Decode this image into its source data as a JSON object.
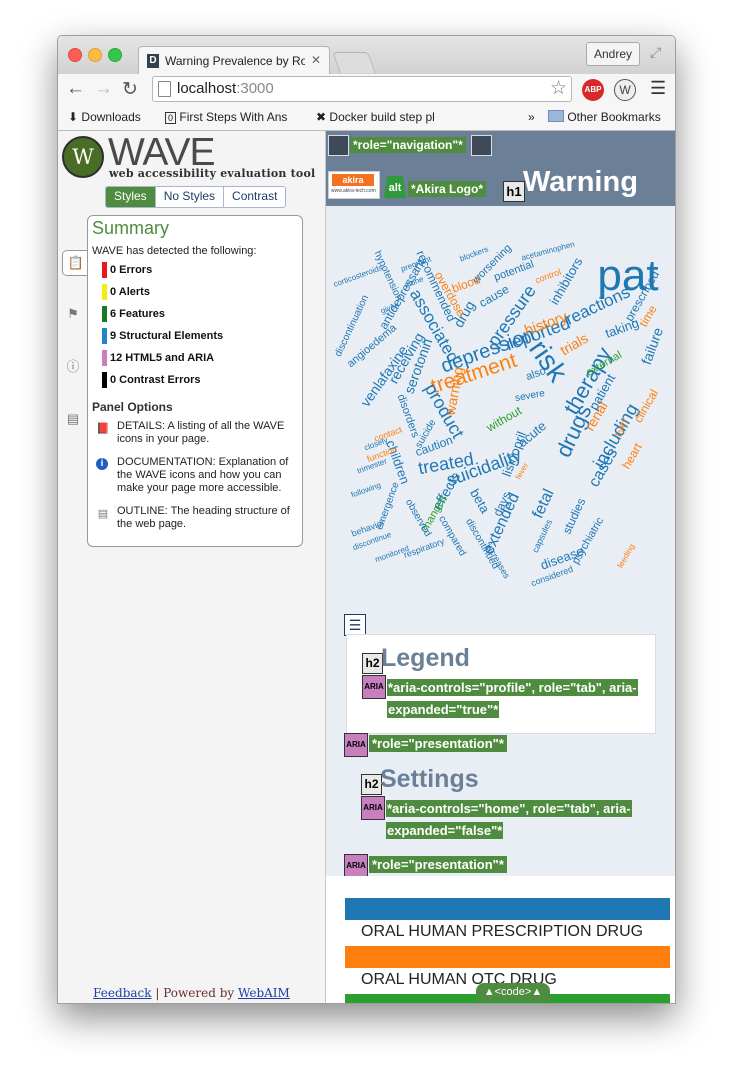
{
  "browser": {
    "tab_title": "Warning Prevalence by Rou",
    "tab_favicon": "D",
    "user": "Andrey",
    "url_host": "localhost",
    "url_port": ":3000",
    "bookmarks": [
      "Downloads",
      "First Steps With Ans",
      "Docker build step pl",
      "Other Bookmarks"
    ],
    "bookmark_overflow": "»"
  },
  "wave": {
    "logo_text": "WAVE",
    "subtitle": "web accessibility evaluation tool",
    "view_buttons": [
      "Styles",
      "No Styles",
      "Contrast"
    ],
    "summary_title": "Summary",
    "detected_text": "WAVE has detected the following:",
    "categories": [
      {
        "label": "0 Errors",
        "color": "#e3191b"
      },
      {
        "label": "0 Alerts",
        "color": "#f5ec16"
      },
      {
        "label": "6 Features",
        "color": "#167a26"
      },
      {
        "label": "9 Structural Elements",
        "color": "#1f86c8"
      },
      {
        "label": "12 HTML5 and ARIA",
        "color": "#c77fc0"
      },
      {
        "label": "0 Contrast Errors",
        "color": "#000000"
      }
    ],
    "panel_options_title": "Panel Options",
    "panel_options": [
      {
        "icon": "book-icon",
        "text": "DETAILS: A listing of all the WAVE icons in your page."
      },
      {
        "icon": "info-icon",
        "text": "DOCUMENTATION: Explanation of the WAVE icons and how you can make your page more accessible."
      },
      {
        "icon": "outline-icon",
        "text": "OUTLINE: The heading structure of the web page."
      }
    ],
    "footer_feedback": "Feedback",
    "footer_sep": " | Powered by ",
    "footer_webaim": "WebAIM"
  },
  "page": {
    "nav_label": "*role=\"navigation\"*",
    "akira_logo": "akira",
    "akira_url": "www.akira-tech.com",
    "alt_badge": "alt",
    "alt_label": "*Akira Logo*",
    "h1_badge": "h1",
    "title": "Warning",
    "word_cloud": [
      {
        "w": "pat",
        "size": 44,
        "color": "#1f77b4"
      },
      {
        "w": "risk",
        "size": 28,
        "color": "#1f77b4"
      },
      {
        "w": "treatment",
        "size": 21,
        "color": "#ff7f0e"
      },
      {
        "w": "therapy",
        "size": 22,
        "color": "#1f77b4"
      },
      {
        "w": "depression",
        "size": 20,
        "color": "#1f77b4"
      },
      {
        "w": "drugs",
        "size": 22,
        "color": "#1f77b4"
      },
      {
        "w": "pressure",
        "size": 18,
        "color": "#1f77b4"
      },
      {
        "w": "reported",
        "size": 18,
        "color": "#1f77b4"
      },
      {
        "w": "product",
        "size": 18,
        "color": "#1f77b4"
      },
      {
        "w": "treated",
        "size": 18,
        "color": "#1f77b4"
      },
      {
        "w": "suicidality",
        "size": 18,
        "color": "#1f77b4"
      },
      {
        "w": "associated",
        "size": 17,
        "color": "#1f77b4"
      },
      {
        "w": "reactions",
        "size": 17,
        "color": "#1f77b4"
      },
      {
        "w": "including",
        "size": 18,
        "color": "#1f77b4"
      },
      {
        "w": "cases",
        "size": 16,
        "color": "#1f77b4"
      },
      {
        "w": "extended",
        "size": 16,
        "color": "#1f77b4"
      },
      {
        "w": "fetal",
        "size": 16,
        "color": "#1f77b4"
      },
      {
        "w": "disease",
        "size": 13,
        "color": "#1f77b4"
      },
      {
        "w": "history",
        "size": 15,
        "color": "#ff7f0e"
      },
      {
        "w": "trials",
        "size": 14,
        "color": "#ff7f0e"
      },
      {
        "w": "renal",
        "size": 14,
        "color": "#ff7f0e"
      },
      {
        "w": "warning",
        "size": 14,
        "color": "#ff7f0e"
      },
      {
        "w": "children",
        "size": 13,
        "color": "#1f77b4"
      },
      {
        "w": "effects",
        "size": 14,
        "color": "#1f77b4"
      },
      {
        "w": "serotonin",
        "size": 14,
        "color": "#1f77b4"
      },
      {
        "w": "receiving",
        "size": 14,
        "color": "#1f77b4"
      },
      {
        "w": "venlafaxine",
        "size": 14,
        "color": "#1f77b4"
      },
      {
        "w": "drug",
        "size": 14,
        "color": "#1f77b4"
      },
      {
        "w": "inhibitors",
        "size": 13,
        "color": "#1f77b4"
      },
      {
        "w": "recommended",
        "size": 12,
        "color": "#1f77b4"
      },
      {
        "w": "antidepressant",
        "size": 12,
        "color": "#1f77b4"
      },
      {
        "w": "caution",
        "size": 12,
        "color": "#1f77b4"
      },
      {
        "w": "lisinopril",
        "size": 13,
        "color": "#1f77b4"
      },
      {
        "w": "acute",
        "size": 13,
        "color": "#1f77b4"
      },
      {
        "w": "beta",
        "size": 13,
        "color": "#1f77b4"
      },
      {
        "w": "days",
        "size": 12,
        "color": "#1f77b4"
      },
      {
        "w": "studies",
        "size": 12,
        "color": "#1f77b4"
      },
      {
        "w": "psychiatric",
        "size": 11,
        "color": "#1f77b4"
      },
      {
        "w": "changes",
        "size": 11,
        "color": "#2ca02c"
      },
      {
        "w": "without",
        "size": 12,
        "color": "#2ca02c"
      },
      {
        "w": "external",
        "size": 11,
        "color": "#2ca02c"
      },
      {
        "w": "overdose",
        "size": 12,
        "color": "#ff7f0e"
      },
      {
        "w": "blood",
        "size": 12,
        "color": "#ff7f0e"
      },
      {
        "w": "angioedema",
        "size": 11,
        "color": "#1f77b4"
      },
      {
        "w": "discontinuation",
        "size": 10,
        "color": "#1f77b4"
      },
      {
        "w": "hypotension",
        "size": 10,
        "color": "#1f77b4"
      },
      {
        "w": "potential",
        "size": 11,
        "color": "#1f77b4"
      },
      {
        "w": "worsening",
        "size": 11,
        "color": "#1f77b4"
      },
      {
        "w": "cause",
        "size": 12,
        "color": "#1f77b4"
      },
      {
        "w": "disorders",
        "size": 11,
        "color": "#1f77b4"
      },
      {
        "w": "severe",
        "size": 10,
        "color": "#1f77b4"
      },
      {
        "w": "emergence",
        "size": 10,
        "color": "#1f77b4"
      },
      {
        "w": "observed",
        "size": 10,
        "color": "#1f77b4"
      },
      {
        "w": "compared",
        "size": 10,
        "color": "#1f77b4"
      },
      {
        "w": "respiratory",
        "size": 9,
        "color": "#1f77b4"
      },
      {
        "w": "discontinued",
        "size": 10,
        "color": "#1f77b4"
      },
      {
        "w": "increases",
        "size": 9,
        "color": "#1f77b4"
      },
      {
        "w": "considered",
        "size": 9,
        "color": "#1f77b4"
      },
      {
        "w": "feeding",
        "size": 8,
        "color": "#ff7f0e"
      },
      {
        "w": "taking",
        "size": 13,
        "color": "#1f77b4"
      },
      {
        "w": "failure",
        "size": 14,
        "color": "#1f77b4"
      },
      {
        "w": "time",
        "size": 12,
        "color": "#ff7f0e"
      },
      {
        "w": "heart",
        "size": 12,
        "color": "#ff7f0e"
      },
      {
        "w": "clinical",
        "size": 12,
        "color": "#ff7f0e"
      },
      {
        "w": "patient",
        "size": 13,
        "color": "#1f77b4"
      },
      {
        "w": "liver",
        "size": 10,
        "color": "#ff7f0e"
      },
      {
        "w": "pregnant",
        "size": 8,
        "color": "#1f77b4"
      },
      {
        "w": "corticosteroids",
        "size": 8,
        "color": "#1f77b4"
      },
      {
        "w": "blockers",
        "size": 8,
        "color": "#1f77b4"
      },
      {
        "w": "acetaminophen",
        "size": 8,
        "color": "#1f77b4"
      },
      {
        "w": "control",
        "size": 9,
        "color": "#ff7f0e"
      },
      {
        "w": "contact",
        "size": 9,
        "color": "#ff7f0e"
      },
      {
        "w": "function",
        "size": 9,
        "color": "#ff7f0e"
      },
      {
        "w": "suicide",
        "size": 10,
        "color": "#1f77b4"
      },
      {
        "w": "alone",
        "size": 8,
        "color": "#1f77b4"
      },
      {
        "w": "given",
        "size": 8,
        "color": "#1f77b4"
      },
      {
        "w": "behavior",
        "size": 9,
        "color": "#1f77b4"
      },
      {
        "w": "discontinue",
        "size": 8,
        "color": "#1f77b4"
      },
      {
        "w": "monitored",
        "size": 8,
        "color": "#1f77b4"
      },
      {
        "w": "following",
        "size": 8,
        "color": "#1f77b4"
      },
      {
        "w": "trimester",
        "size": 8,
        "color": "#1f77b4"
      },
      {
        "w": "closely",
        "size": 8,
        "color": "#1f77b4"
      },
      {
        "w": "fever",
        "size": 8,
        "color": "#ff7f0e"
      },
      {
        "w": "also",
        "size": 11,
        "color": "#1f77b4"
      },
      {
        "w": "capsules",
        "size": 9,
        "color": "#1f77b4"
      },
      {
        "w": "prescribed",
        "size": 12,
        "color": "#1f77b4"
      }
    ],
    "legend": {
      "h2_badge": "h2",
      "heading": "Legend",
      "aria_badge": "ARIA",
      "aria_label": "*aria-controls=\"profile\", role=\"tab\", aria-expanded=\"true\"*"
    },
    "presentation_label": "*role=\"presentation\"*",
    "settings": {
      "h2_badge": "h2",
      "heading": "Settings",
      "aria_badge": "ARIA",
      "aria_label": "*aria-controls=\"home\", role=\"tab\", aria-expanded=\"false\"*"
    },
    "drug_rows": [
      "ORAL HUMAN PRESCRIPTION DRUG",
      "ORAL HUMAN OTC DRUG"
    ],
    "row_colors": [
      "#1f77b4",
      "#ff7f0e",
      "#2ca02c"
    ],
    "code_tab": "▲<code>▲"
  }
}
